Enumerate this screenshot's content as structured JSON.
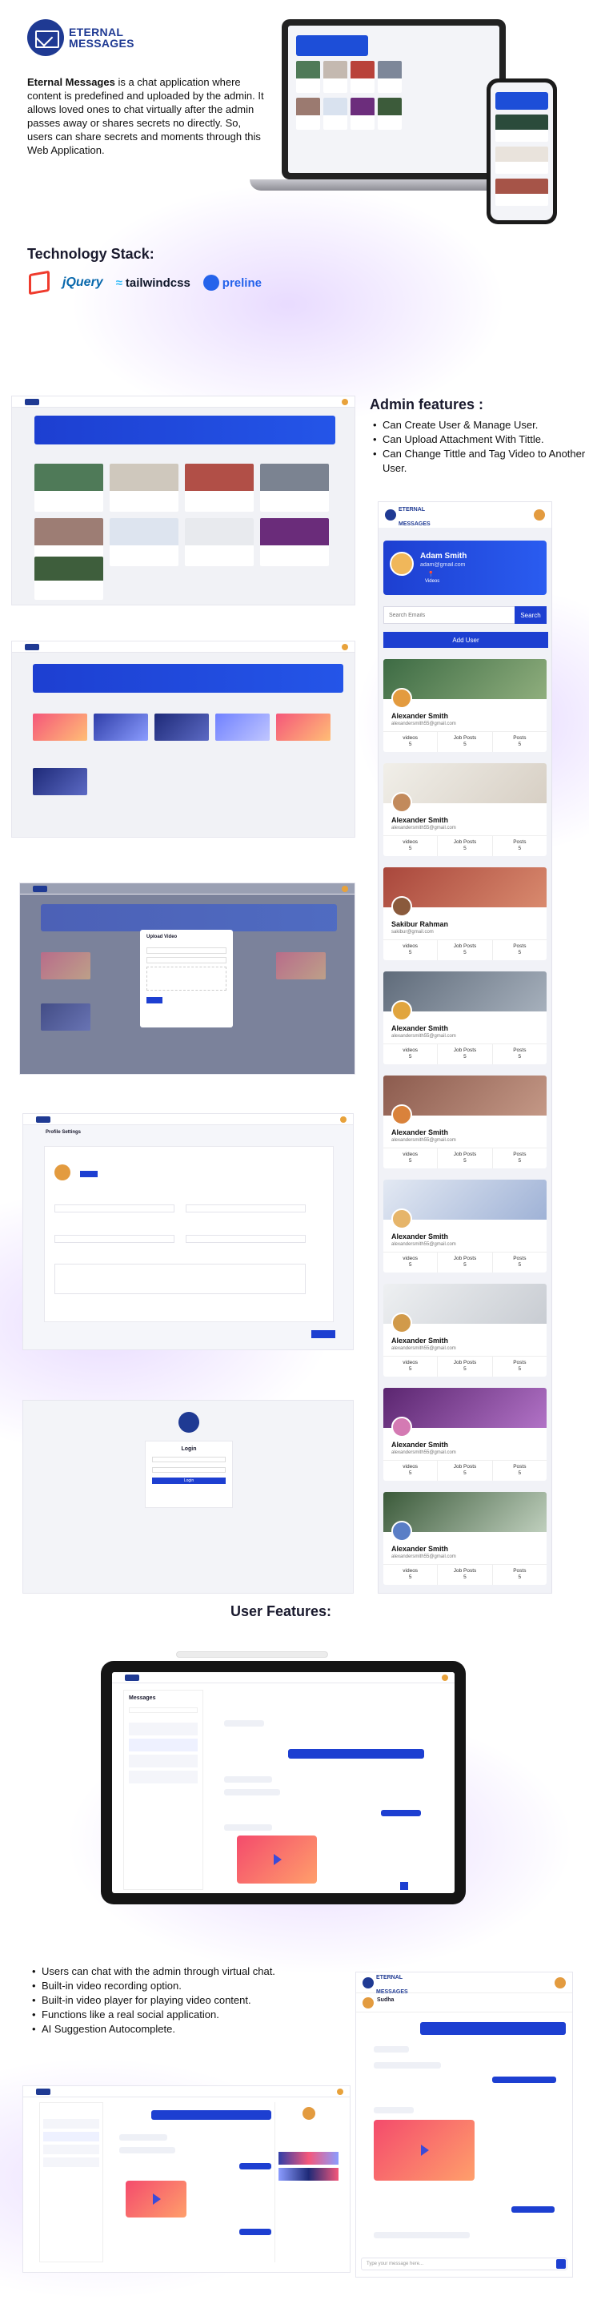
{
  "brand": {
    "line1": "ETERNAL",
    "line2": "MESSAGES"
  },
  "intro": {
    "bold": "Eternal Messages",
    "text": " is a chat application where content is predefined and uploaded by the admin. It allows loved ones to chat virtually after the admin passes away or shares secrets no directly. So, users can share secrets and moments through this Web Application."
  },
  "tech": {
    "heading": "Technology Stack:",
    "items": [
      "jQuery",
      "tailwindcss",
      "preline"
    ]
  },
  "admin": {
    "heading": "Admin features :",
    "features": [
      "Can Create User & Manage User.",
      "Can Upload Attachment With Tittle.",
      "Can Change Tittle and Tag Video to Another User."
    ]
  },
  "mobile": {
    "logo1": "ETERNAL",
    "logo2": "MESSAGES",
    "profile_name": "Adam Smith",
    "profile_email": "adam@gmail.com",
    "profile_videos": "Videos",
    "search_placeholder": "Search Emails",
    "search_button": "Search",
    "add_button": "Add User",
    "stat_labels": [
      "videos",
      "Job Posts",
      "Posts"
    ],
    "stat_values": [
      "5",
      "5",
      "5"
    ],
    "users": [
      {
        "name": "Alexander Smith",
        "email": "alexandersmith55@gmail.com"
      },
      {
        "name": "Alexander Smith",
        "email": "alexandersmith55@gmail.com"
      },
      {
        "name": "Sakibur Rahman",
        "email": "sakibur@gmail.com"
      },
      {
        "name": "Alexander Smith",
        "email": "alexandersmith55@gmail.com"
      },
      {
        "name": "Alexander Smith",
        "email": "alexandersmith55@gmail.com"
      },
      {
        "name": "Alexander Smith",
        "email": "alexandersmith55@gmail.com"
      },
      {
        "name": "Alexander Smith",
        "email": "alexandersmith55@gmail.com"
      },
      {
        "name": "Alexander Smith",
        "email": "alexandersmith55@gmail.com"
      },
      {
        "name": "Alexander Smith",
        "email": "alexandersmith55@gmail.com"
      }
    ]
  },
  "screens": {
    "upload_title": "Upload Video",
    "profile_title": "Profile Settings",
    "login_title": "Login",
    "login_button": "Login",
    "messages_title": "Messages"
  },
  "user_section": {
    "heading": "User Features:",
    "features": [
      "Users can chat with the admin through virtual chat.",
      "Built-in video recording option.",
      "Built-in video player for playing video content.",
      "Functions like a real social application.",
      "AI Suggestion Autocomplete."
    ]
  },
  "mobile_chat": {
    "contact": "Sudha",
    "input_placeholder": "Type your message here..."
  },
  "colors": {
    "primary": "#1d3fd1",
    "brand": "#1f3a93",
    "accent": "#e39b3f"
  }
}
